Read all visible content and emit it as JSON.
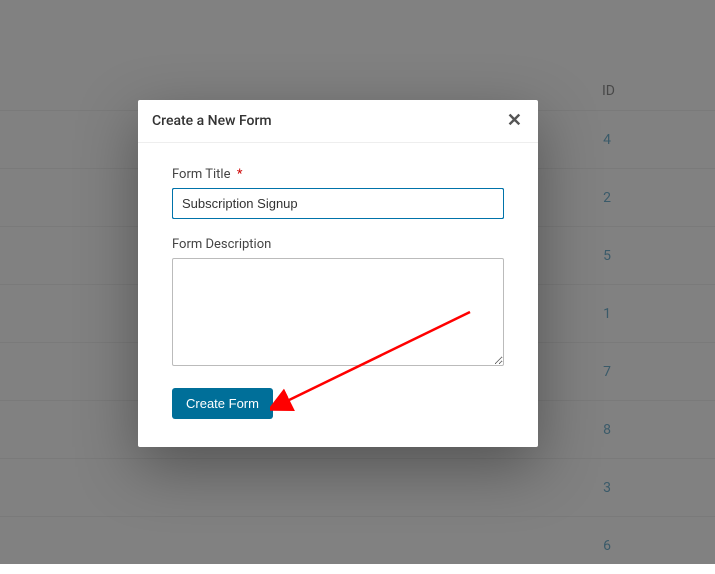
{
  "table": {
    "header": {
      "id_label": "ID"
    },
    "rows": [
      {
        "id": "4"
      },
      {
        "id": "2"
      },
      {
        "id": "5"
      },
      {
        "id": "1"
      },
      {
        "id": "7"
      },
      {
        "id": "8"
      },
      {
        "id": "3"
      },
      {
        "id": "6"
      }
    ]
  },
  "modal": {
    "title": "Create a New Form",
    "form_title_label": "Form Title",
    "required_mark": "*",
    "form_title_value": "Subscription Signup",
    "form_desc_label": "Form Description",
    "form_desc_value": "",
    "submit_label": "Create Form"
  }
}
